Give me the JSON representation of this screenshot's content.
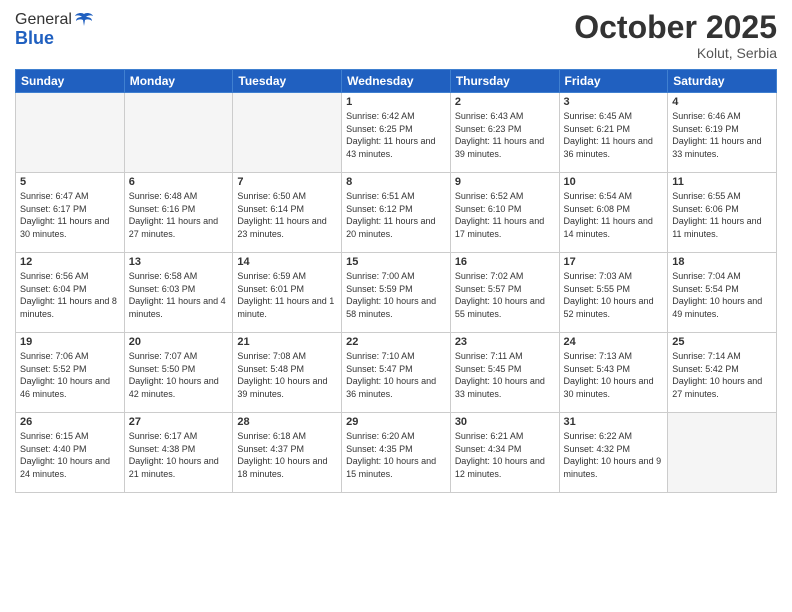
{
  "header": {
    "logo_line1": "General",
    "logo_line2": "Blue",
    "month": "October 2025",
    "location": "Kolut, Serbia"
  },
  "weekdays": [
    "Sunday",
    "Monday",
    "Tuesday",
    "Wednesday",
    "Thursday",
    "Friday",
    "Saturday"
  ],
  "weeks": [
    [
      {
        "day": "",
        "content": ""
      },
      {
        "day": "",
        "content": ""
      },
      {
        "day": "",
        "content": ""
      },
      {
        "day": "1",
        "content": "Sunrise: 6:42 AM\nSunset: 6:25 PM\nDaylight: 11 hours\nand 43 minutes."
      },
      {
        "day": "2",
        "content": "Sunrise: 6:43 AM\nSunset: 6:23 PM\nDaylight: 11 hours\nand 39 minutes."
      },
      {
        "day": "3",
        "content": "Sunrise: 6:45 AM\nSunset: 6:21 PM\nDaylight: 11 hours\nand 36 minutes."
      },
      {
        "day": "4",
        "content": "Sunrise: 6:46 AM\nSunset: 6:19 PM\nDaylight: 11 hours\nand 33 minutes."
      }
    ],
    [
      {
        "day": "5",
        "content": "Sunrise: 6:47 AM\nSunset: 6:17 PM\nDaylight: 11 hours\nand 30 minutes."
      },
      {
        "day": "6",
        "content": "Sunrise: 6:48 AM\nSunset: 6:16 PM\nDaylight: 11 hours\nand 27 minutes."
      },
      {
        "day": "7",
        "content": "Sunrise: 6:50 AM\nSunset: 6:14 PM\nDaylight: 11 hours\nand 23 minutes."
      },
      {
        "day": "8",
        "content": "Sunrise: 6:51 AM\nSunset: 6:12 PM\nDaylight: 11 hours\nand 20 minutes."
      },
      {
        "day": "9",
        "content": "Sunrise: 6:52 AM\nSunset: 6:10 PM\nDaylight: 11 hours\nand 17 minutes."
      },
      {
        "day": "10",
        "content": "Sunrise: 6:54 AM\nSunset: 6:08 PM\nDaylight: 11 hours\nand 14 minutes."
      },
      {
        "day": "11",
        "content": "Sunrise: 6:55 AM\nSunset: 6:06 PM\nDaylight: 11 hours\nand 11 minutes."
      }
    ],
    [
      {
        "day": "12",
        "content": "Sunrise: 6:56 AM\nSunset: 6:04 PM\nDaylight: 11 hours\nand 8 minutes."
      },
      {
        "day": "13",
        "content": "Sunrise: 6:58 AM\nSunset: 6:03 PM\nDaylight: 11 hours\nand 4 minutes."
      },
      {
        "day": "14",
        "content": "Sunrise: 6:59 AM\nSunset: 6:01 PM\nDaylight: 11 hours\nand 1 minute."
      },
      {
        "day": "15",
        "content": "Sunrise: 7:00 AM\nSunset: 5:59 PM\nDaylight: 10 hours\nand 58 minutes."
      },
      {
        "day": "16",
        "content": "Sunrise: 7:02 AM\nSunset: 5:57 PM\nDaylight: 10 hours\nand 55 minutes."
      },
      {
        "day": "17",
        "content": "Sunrise: 7:03 AM\nSunset: 5:55 PM\nDaylight: 10 hours\nand 52 minutes."
      },
      {
        "day": "18",
        "content": "Sunrise: 7:04 AM\nSunset: 5:54 PM\nDaylight: 10 hours\nand 49 minutes."
      }
    ],
    [
      {
        "day": "19",
        "content": "Sunrise: 7:06 AM\nSunset: 5:52 PM\nDaylight: 10 hours\nand 46 minutes."
      },
      {
        "day": "20",
        "content": "Sunrise: 7:07 AM\nSunset: 5:50 PM\nDaylight: 10 hours\nand 42 minutes."
      },
      {
        "day": "21",
        "content": "Sunrise: 7:08 AM\nSunset: 5:48 PM\nDaylight: 10 hours\nand 39 minutes."
      },
      {
        "day": "22",
        "content": "Sunrise: 7:10 AM\nSunset: 5:47 PM\nDaylight: 10 hours\nand 36 minutes."
      },
      {
        "day": "23",
        "content": "Sunrise: 7:11 AM\nSunset: 5:45 PM\nDaylight: 10 hours\nand 33 minutes."
      },
      {
        "day": "24",
        "content": "Sunrise: 7:13 AM\nSunset: 5:43 PM\nDaylight: 10 hours\nand 30 minutes."
      },
      {
        "day": "25",
        "content": "Sunrise: 7:14 AM\nSunset: 5:42 PM\nDaylight: 10 hours\nand 27 minutes."
      }
    ],
    [
      {
        "day": "26",
        "content": "Sunrise: 6:15 AM\nSunset: 4:40 PM\nDaylight: 10 hours\nand 24 minutes."
      },
      {
        "day": "27",
        "content": "Sunrise: 6:17 AM\nSunset: 4:38 PM\nDaylight: 10 hours\nand 21 minutes."
      },
      {
        "day": "28",
        "content": "Sunrise: 6:18 AM\nSunset: 4:37 PM\nDaylight: 10 hours\nand 18 minutes."
      },
      {
        "day": "29",
        "content": "Sunrise: 6:20 AM\nSunset: 4:35 PM\nDaylight: 10 hours\nand 15 minutes."
      },
      {
        "day": "30",
        "content": "Sunrise: 6:21 AM\nSunset: 4:34 PM\nDaylight: 10 hours\nand 12 minutes."
      },
      {
        "day": "31",
        "content": "Sunrise: 6:22 AM\nSunset: 4:32 PM\nDaylight: 10 hours\nand 9 minutes."
      },
      {
        "day": "",
        "content": ""
      }
    ]
  ]
}
